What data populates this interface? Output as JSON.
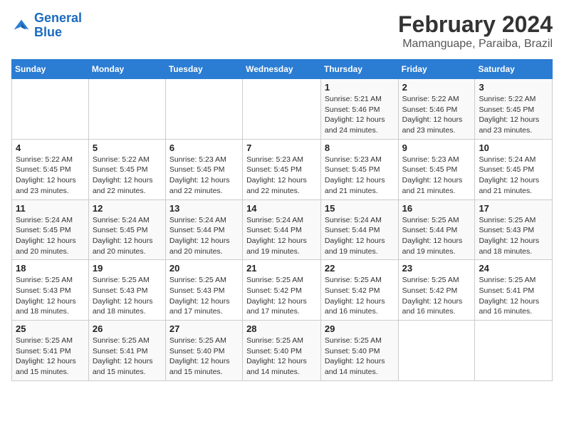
{
  "logo": {
    "line1": "General",
    "line2": "Blue"
  },
  "title": "February 2024",
  "subtitle": "Mamanguape, Paraiba, Brazil",
  "weekdays": [
    "Sunday",
    "Monday",
    "Tuesday",
    "Wednesday",
    "Thursday",
    "Friday",
    "Saturday"
  ],
  "weeks": [
    [
      {
        "day": "",
        "info": ""
      },
      {
        "day": "",
        "info": ""
      },
      {
        "day": "",
        "info": ""
      },
      {
        "day": "",
        "info": ""
      },
      {
        "day": "1",
        "info": "Sunrise: 5:21 AM\nSunset: 5:46 PM\nDaylight: 12 hours\nand 24 minutes."
      },
      {
        "day": "2",
        "info": "Sunrise: 5:22 AM\nSunset: 5:46 PM\nDaylight: 12 hours\nand 23 minutes."
      },
      {
        "day": "3",
        "info": "Sunrise: 5:22 AM\nSunset: 5:45 PM\nDaylight: 12 hours\nand 23 minutes."
      }
    ],
    [
      {
        "day": "4",
        "info": "Sunrise: 5:22 AM\nSunset: 5:45 PM\nDaylight: 12 hours\nand 23 minutes."
      },
      {
        "day": "5",
        "info": "Sunrise: 5:22 AM\nSunset: 5:45 PM\nDaylight: 12 hours\nand 22 minutes."
      },
      {
        "day": "6",
        "info": "Sunrise: 5:23 AM\nSunset: 5:45 PM\nDaylight: 12 hours\nand 22 minutes."
      },
      {
        "day": "7",
        "info": "Sunrise: 5:23 AM\nSunset: 5:45 PM\nDaylight: 12 hours\nand 22 minutes."
      },
      {
        "day": "8",
        "info": "Sunrise: 5:23 AM\nSunset: 5:45 PM\nDaylight: 12 hours\nand 21 minutes."
      },
      {
        "day": "9",
        "info": "Sunrise: 5:23 AM\nSunset: 5:45 PM\nDaylight: 12 hours\nand 21 minutes."
      },
      {
        "day": "10",
        "info": "Sunrise: 5:24 AM\nSunset: 5:45 PM\nDaylight: 12 hours\nand 21 minutes."
      }
    ],
    [
      {
        "day": "11",
        "info": "Sunrise: 5:24 AM\nSunset: 5:45 PM\nDaylight: 12 hours\nand 20 minutes."
      },
      {
        "day": "12",
        "info": "Sunrise: 5:24 AM\nSunset: 5:45 PM\nDaylight: 12 hours\nand 20 minutes."
      },
      {
        "day": "13",
        "info": "Sunrise: 5:24 AM\nSunset: 5:44 PM\nDaylight: 12 hours\nand 20 minutes."
      },
      {
        "day": "14",
        "info": "Sunrise: 5:24 AM\nSunset: 5:44 PM\nDaylight: 12 hours\nand 19 minutes."
      },
      {
        "day": "15",
        "info": "Sunrise: 5:24 AM\nSunset: 5:44 PM\nDaylight: 12 hours\nand 19 minutes."
      },
      {
        "day": "16",
        "info": "Sunrise: 5:25 AM\nSunset: 5:44 PM\nDaylight: 12 hours\nand 19 minutes."
      },
      {
        "day": "17",
        "info": "Sunrise: 5:25 AM\nSunset: 5:43 PM\nDaylight: 12 hours\nand 18 minutes."
      }
    ],
    [
      {
        "day": "18",
        "info": "Sunrise: 5:25 AM\nSunset: 5:43 PM\nDaylight: 12 hours\nand 18 minutes."
      },
      {
        "day": "19",
        "info": "Sunrise: 5:25 AM\nSunset: 5:43 PM\nDaylight: 12 hours\nand 18 minutes."
      },
      {
        "day": "20",
        "info": "Sunrise: 5:25 AM\nSunset: 5:43 PM\nDaylight: 12 hours\nand 17 minutes."
      },
      {
        "day": "21",
        "info": "Sunrise: 5:25 AM\nSunset: 5:42 PM\nDaylight: 12 hours\nand 17 minutes."
      },
      {
        "day": "22",
        "info": "Sunrise: 5:25 AM\nSunset: 5:42 PM\nDaylight: 12 hours\nand 16 minutes."
      },
      {
        "day": "23",
        "info": "Sunrise: 5:25 AM\nSunset: 5:42 PM\nDaylight: 12 hours\nand 16 minutes."
      },
      {
        "day": "24",
        "info": "Sunrise: 5:25 AM\nSunset: 5:41 PM\nDaylight: 12 hours\nand 16 minutes."
      }
    ],
    [
      {
        "day": "25",
        "info": "Sunrise: 5:25 AM\nSunset: 5:41 PM\nDaylight: 12 hours\nand 15 minutes."
      },
      {
        "day": "26",
        "info": "Sunrise: 5:25 AM\nSunset: 5:41 PM\nDaylight: 12 hours\nand 15 minutes."
      },
      {
        "day": "27",
        "info": "Sunrise: 5:25 AM\nSunset: 5:40 PM\nDaylight: 12 hours\nand 15 minutes."
      },
      {
        "day": "28",
        "info": "Sunrise: 5:25 AM\nSunset: 5:40 PM\nDaylight: 12 hours\nand 14 minutes."
      },
      {
        "day": "29",
        "info": "Sunrise: 5:25 AM\nSunset: 5:40 PM\nDaylight: 12 hours\nand 14 minutes."
      },
      {
        "day": "",
        "info": ""
      },
      {
        "day": "",
        "info": ""
      }
    ]
  ]
}
